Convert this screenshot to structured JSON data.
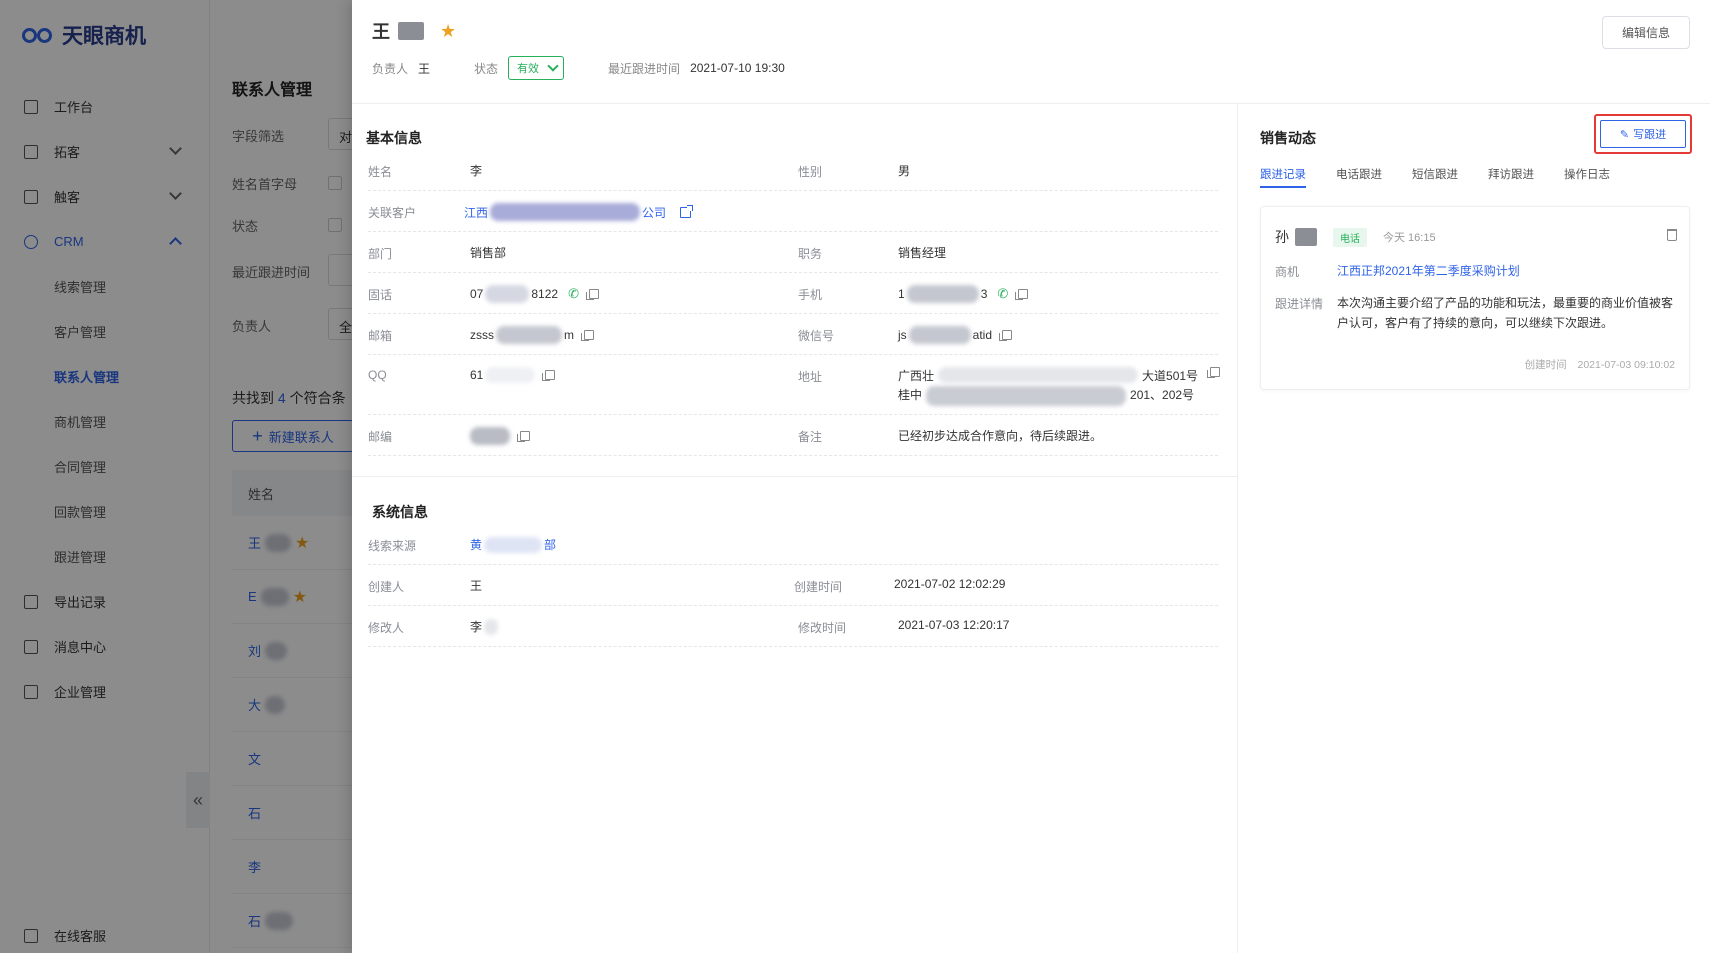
{
  "app": {
    "logo_text": "天眼商机"
  },
  "sidebar": {
    "items": [
      {
        "label": "工作台",
        "icon": "monitor-icon"
      },
      {
        "label": "拓客",
        "icon": "briefcase-icon",
        "expandable": true
      },
      {
        "label": "触客",
        "icon": "target-icon",
        "expandable": true
      },
      {
        "label": "CRM",
        "icon": "users-icon",
        "expanded": true
      },
      {
        "label": "导出记录",
        "icon": "export-icon"
      },
      {
        "label": "消息中心",
        "icon": "bell-icon"
      },
      {
        "label": "企业管理",
        "icon": "chart-icon"
      }
    ],
    "crm_sub": [
      "线索管理",
      "客户管理",
      "联系人管理",
      "商机管理",
      "合同管理",
      "回款管理",
      "跟进管理"
    ],
    "bottom_label": "在线客服",
    "collapse_glyph": "«"
  },
  "listpage": {
    "title": "联系人管理",
    "filters": [
      "字段筛选",
      "姓名首字母",
      "状态",
      "最近跟进时间",
      "负责人"
    ],
    "field_filter_value": "对",
    "owner_filter_value": "全",
    "found_prefix": "共找到",
    "found_count": "4",
    "found_suffix": "个符合条",
    "new_button": "新建联系人",
    "column_name": "姓名",
    "rows": [
      "王",
      "E",
      "刘",
      "大",
      "文",
      "石",
      "李",
      "石"
    ]
  },
  "drawer": {
    "name_char": "王",
    "edit_button": "编辑信息",
    "owner_label": "负责人",
    "owner_value": "王",
    "status_label": "状态",
    "status_value": "有效",
    "last_follow_label": "最近跟进时间",
    "last_follow_value": "2021-07-10 19:30",
    "basic": {
      "title": "基本信息",
      "name_label": "姓名",
      "name_value": "李",
      "gender_label": "性别",
      "gender_value": "男",
      "customer_label": "关联客户",
      "customer_prefix": "江西",
      "customer_suffix": "公司",
      "dept_label": "部门",
      "dept_value": "销售部",
      "title_label": "职务",
      "title_value": "销售经理",
      "tel_label": "固话",
      "tel_prefix": "07",
      "tel_suffix": "8122",
      "mobile_label": "手机",
      "mobile_prefix": "1",
      "mobile_suffix": "3",
      "email_label": "邮箱",
      "email_prefix": "zsss",
      "email_suffix": "m",
      "wechat_label": "微信号",
      "wechat_prefix": "js",
      "wechat_suffix": "atid",
      "qq_label": "QQ",
      "qq_value": "61",
      "addr_label": "地址",
      "addr_line1_prefix": "广西壮",
      "addr_line1_suffix": "大道501号",
      "addr_line2_prefix": "桂中",
      "addr_line2_suffix": "201、202号",
      "zip_label": "邮编",
      "note_label": "备注",
      "note_value": "已经初步达成合作意向，待后续跟进。"
    },
    "system": {
      "title": "系统信息",
      "source_label": "线索来源",
      "source_prefix": "黄",
      "source_suffix": "部",
      "creator_label": "创建人",
      "creator_value": "王",
      "created_label": "创建时间",
      "created_value": "2021-07-02 12:02:29",
      "modifier_label": "修改人",
      "modifier_value": "李",
      "modified_label": "修改时间",
      "modified_value": "2021-07-03 12:20:17"
    },
    "sales": {
      "title": "销售动态",
      "write_button": "写跟进",
      "tabs": [
        "跟进记录",
        "电话跟进",
        "短信跟进",
        "拜访跟进",
        "操作日志"
      ],
      "record": {
        "user": "孙",
        "type": "电话",
        "time": "今天 16:15",
        "opp_label": "商机",
        "opp_value": "江西正邦2021年第二季度采购计划",
        "detail_label": "跟进详情",
        "detail_value": "本次沟通主要介绍了产品的功能和玩法，最重要的商业价值被客户认可，客户有了持续的意向，可以继续下次跟进。",
        "created_label": "创建时间",
        "created_value": "2021-07-03 09:10:02"
      }
    }
  },
  "colors": {
    "accent": "#2f63e8",
    "success": "#27b05a",
    "highlight": "#e53935",
    "star": "#f0a020"
  }
}
